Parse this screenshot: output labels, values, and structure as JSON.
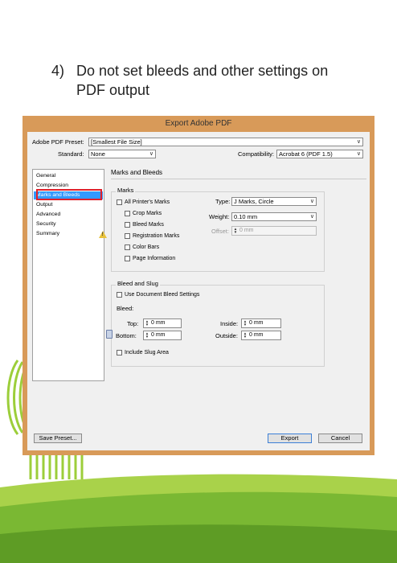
{
  "heading": {
    "number": "4)",
    "text": "Do not set bleeds and other settings on PDF output"
  },
  "dialog": {
    "title": "Export Adobe PDF",
    "preset_label": "Adobe PDF Preset:",
    "preset_value": "[Smallest File Size]",
    "standard_label": "Standard:",
    "standard_value": "None",
    "compat_label": "Compatibility:",
    "compat_value": "Acrobat 6 (PDF 1.5)",
    "sidebar": [
      {
        "label": "General"
      },
      {
        "label": "Compression"
      },
      {
        "label": "Marks and Bleeds"
      },
      {
        "label": "Output"
      },
      {
        "label": "Advanced"
      },
      {
        "label": "Security"
      },
      {
        "label": "Summary"
      }
    ],
    "section_title": "Marks and Bleeds",
    "marks": {
      "group_title": "Marks",
      "all_printers_marks": "All Printer's Marks",
      "crop_marks": "Crop Marks",
      "bleed_marks": "Bleed Marks",
      "registration_marks": "Registration Marks",
      "color_bars": "Color Bars",
      "page_information": "Page Information",
      "type_label": "Type:",
      "type_value": "J Marks, Circle",
      "weight_label": "Weight:",
      "weight_value": "0.10 mm",
      "offset_label": "Offset:",
      "offset_value": "0 mm"
    },
    "bleed": {
      "group_title": "Bleed and Slug",
      "use_document": "Use Document Bleed Settings",
      "bleed_label": "Bleed:",
      "top_label": "Top:",
      "top_value": "0 mm",
      "bottom_label": "Bottom:",
      "bottom_value": "0 mm",
      "inside_label": "Inside:",
      "inside_value": "0 mm",
      "outside_label": "Outside:",
      "outside_value": "0 mm",
      "include_slug": "Include Slug Area"
    },
    "buttons": {
      "save_preset": "Save Preset...",
      "export": "Export",
      "cancel": "Cancel"
    }
  },
  "colors": {
    "dialog_frame": "#d89a59",
    "selection": "#3399ff",
    "highlight": "#e0202a",
    "grass": "#7ab833"
  }
}
